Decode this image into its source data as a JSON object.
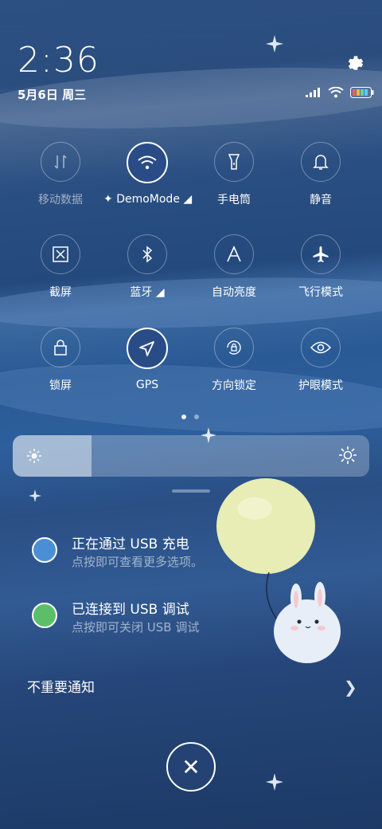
{
  "status_bar": {
    "time": "2:36",
    "date": "5月6日 周三",
    "signal_icon": "signal-bars-icon",
    "wifi_icon": "wifi-icon",
    "battery_icon": "battery-icon"
  },
  "header": {
    "settings_icon": "gear-icon"
  },
  "tiles": [
    {
      "label": "移动数据",
      "icon": "mobile-data-icon",
      "active": false
    },
    {
      "label": "DemoMode",
      "icon": "wifi-icon",
      "active": true
    },
    {
      "label": "手电筒",
      "icon": "flashlight-icon",
      "active": false
    },
    {
      "label": "静音",
      "icon": "bell-icon",
      "active": false
    },
    {
      "label": "截屏",
      "icon": "screenshot-icon",
      "active": false
    },
    {
      "label": "蓝牙",
      "icon": "bluetooth-icon",
      "active": false
    },
    {
      "label": "自动亮度",
      "icon": "auto-brightness-icon",
      "active": false
    },
    {
      "label": "飞行模式",
      "icon": "airplane-icon",
      "active": false
    },
    {
      "label": "锁屏",
      "icon": "lock-icon",
      "active": false
    },
    {
      "label": "GPS",
      "icon": "location-arrow-icon",
      "active": true
    },
    {
      "label": "方向锁定",
      "icon": "rotation-lock-icon",
      "active": false
    },
    {
      "label": "护眼模式",
      "icon": "eye-icon",
      "active": false
    }
  ],
  "brightness": {
    "level": 0.22
  },
  "notifications": [
    {
      "title": "正在通过 USB 充电",
      "subtitle": "点按即可查看更多选项。",
      "icon": "usb-icon",
      "color": "#4a8fd6"
    },
    {
      "title": "已连接到 USB 调试",
      "subtitle": "点按即可关闭 USB 调试",
      "icon": "android-debug-icon",
      "color": "#5bbf6a"
    }
  ],
  "unimportant": {
    "label": "不重要通知"
  },
  "colors": {
    "accent_on": "#2a4c86",
    "balloon": "#e7edb4"
  }
}
